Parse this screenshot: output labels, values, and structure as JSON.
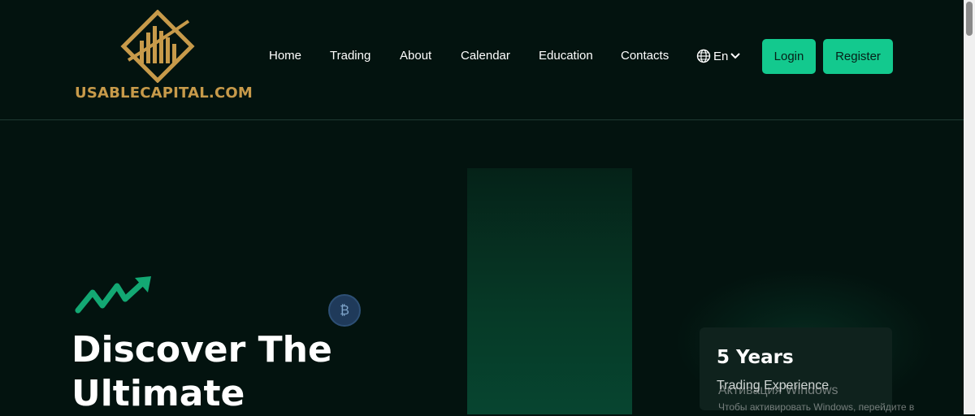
{
  "logo": {
    "text": "USABLECAPITAL.COM"
  },
  "nav": {
    "items": [
      {
        "label": "Home"
      },
      {
        "label": "Trading"
      },
      {
        "label": "About"
      },
      {
        "label": "Calendar"
      },
      {
        "label": "Education"
      },
      {
        "label": "Contacts"
      }
    ],
    "language": "En"
  },
  "auth": {
    "login_label": "Login",
    "register_label": "Register"
  },
  "hero": {
    "title_line1": "Discover The",
    "title_line2": "Ultimate"
  },
  "stat": {
    "value": "5 Years",
    "label": "Trading Experience"
  },
  "windows_watermark": {
    "title": "Активация Windows",
    "subtitle": "Чтобы активировать Windows, перейдите в"
  },
  "colors": {
    "background": "#03130f",
    "accent": "#13c98e",
    "logo_gold": "#c79a4a"
  },
  "icons": [
    "logo-mark-icon",
    "globe-icon",
    "chevron-down-icon",
    "trend-arrow-icon",
    "bitcoin-coin-icon"
  ]
}
